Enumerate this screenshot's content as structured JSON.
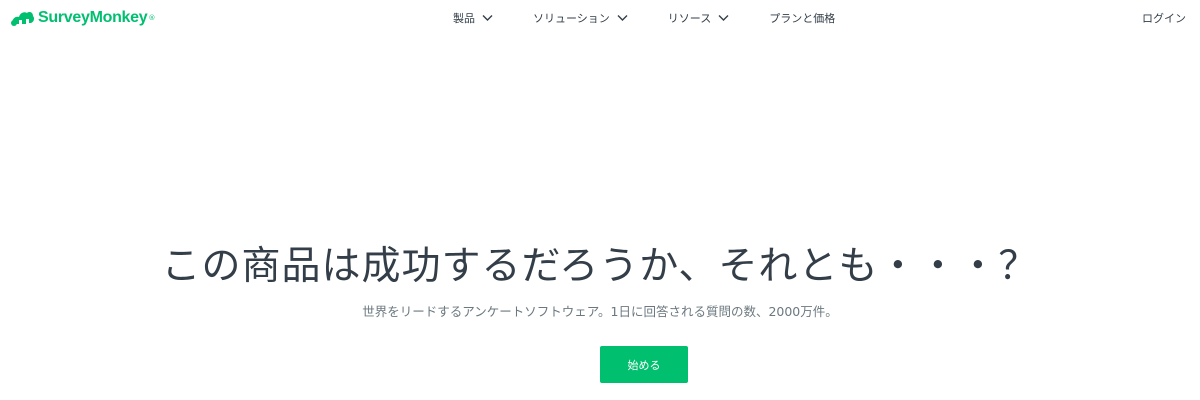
{
  "brand": {
    "name": "SurveyMonkey",
    "trademark": "®",
    "color": "#00bf6f",
    "icon": "survey-monkey-logo-icon"
  },
  "nav": {
    "items": [
      {
        "label": "製品",
        "icon": "chevron-down-icon"
      },
      {
        "label": "ソリューション",
        "icon": "chevron-down-icon"
      },
      {
        "label": "リソース",
        "icon": "chevron-down-icon"
      },
      {
        "label": "プランと価格"
      }
    ],
    "login_label": "ログイン"
  },
  "hero": {
    "title": "この商品は成功するだろうか、それとも・・・？",
    "subtitle": "世界をリードするアンケートソフトウェア。1日に回答される質問の数、2000万件。",
    "cta_label": "始める"
  }
}
